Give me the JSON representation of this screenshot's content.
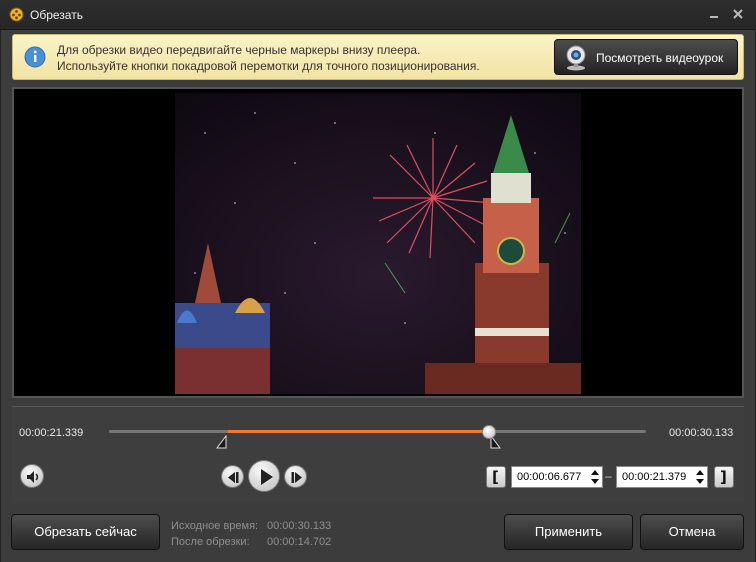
{
  "window": {
    "title": "Обрезать"
  },
  "info": {
    "line1": "Для обрезки видео передвигайте черные маркеры внизу плеера.",
    "line2": "Используйте кнопки покадровой перемотки для точного позиционирования.",
    "tutorial_label": "Посмотреть видеоурок"
  },
  "timeline": {
    "current_time": "00:00:21.339",
    "total_time": "00:00:30.133",
    "selection_start_fraction": 0.221,
    "selection_end_fraction": 0.708,
    "playhead_fraction": 0.708
  },
  "range": {
    "start": "00:00:06.677",
    "end": "00:00:21.379",
    "separator": "–"
  },
  "stats": {
    "source_label": "Исходное время:",
    "source_value": "00:00:30.133",
    "after_label": "После обрезки:",
    "after_value": "00:00:14.702"
  },
  "buttons": {
    "cut_now": "Обрезать сейчас",
    "apply": "Применить",
    "cancel": "Отмена"
  },
  "colors": {
    "accent": "#f07a2c",
    "info_bg": "#f6ebb5"
  }
}
